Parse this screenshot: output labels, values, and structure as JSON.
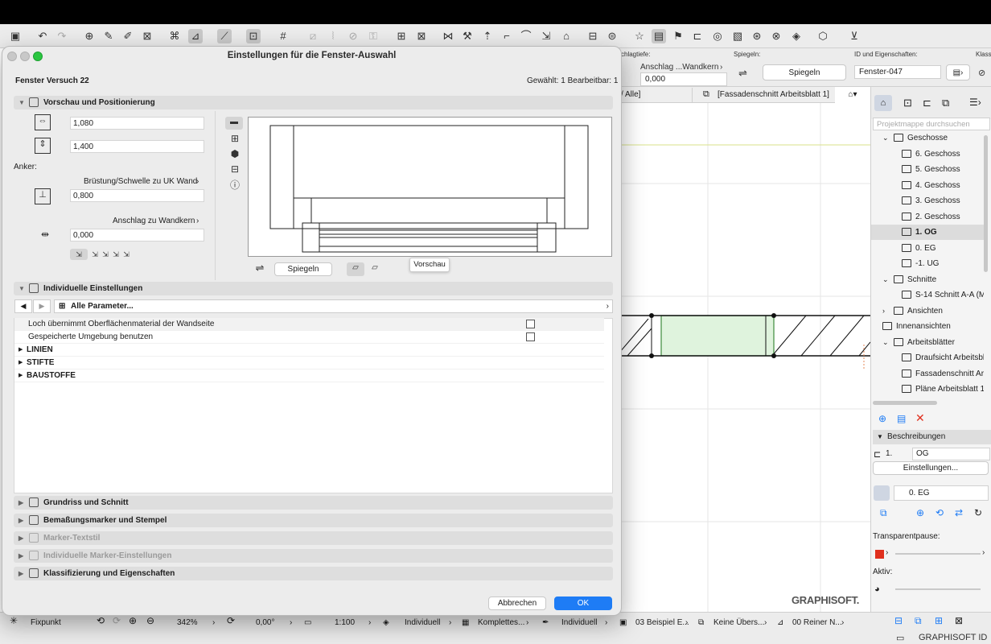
{
  "dialog": {
    "title": "Einstellungen für die Fenster-Auswahl",
    "element_name": "Fenster Versuch 22",
    "selection_info": "Gewählt: 1 Bearbeitbar: 1",
    "preview_section": {
      "title": "Vorschau und Positionierung",
      "width_value": "1,080",
      "height_value": "1,400",
      "anchor_label": "Anker:",
      "sill_label": "Brüstung/Schwelle zu UK Wand",
      "sill_value": "0,800",
      "reveal_label": "Anschlag zu Wandkern",
      "reveal_value": "0,000",
      "mirror_button": "Spiegeln",
      "tooltip": "Vorschau"
    },
    "custom_section": {
      "title": "Individuelle Einstellungen",
      "param_selector": "Alle Parameter...",
      "rows": [
        {
          "label": "Loch übernimmt Oberflächenmaterial der Wandseite",
          "checked": false
        },
        {
          "label": "Gespeicherte Umgebung benutzen",
          "checked": false
        }
      ],
      "groups": [
        "LINIEN",
        "STIFTE",
        "BAUSTOFFE"
      ]
    },
    "collapsed_sections": [
      {
        "title": "Grundriss und Schnitt",
        "enabled": true
      },
      {
        "title": "Bemaßungsmarker und Stempel",
        "enabled": true
      },
      {
        "title": "Marker-Textstil",
        "enabled": false
      },
      {
        "title": "Individuelle Marker-Einstellungen",
        "enabled": false
      },
      {
        "title": "Klassifizierung und Eigenschaften",
        "enabled": true
      }
    ],
    "cancel_label": "Abbrechen",
    "ok_label": "OK"
  },
  "infobox": {
    "depth_label": "chlagtiefe:",
    "reveal_label": "Anschlag ...Wandkern",
    "reveal_value": "0,000",
    "mirror_label": "Spiegeln:",
    "mirror_button": "Spiegeln",
    "id_label": "ID und Eigenschaften:",
    "id_value": "Fenster-047",
    "klass_label": "Klass"
  },
  "view_tabs": {
    "tab1": "/ Alle]",
    "tab2": "[Fassadenschnitt  Arbeitsblatt 1]"
  },
  "navigator": {
    "search_placeholder": "Projektmappe durchsuchen",
    "items": [
      {
        "label": "Geschosse",
        "indent": 0,
        "expanded": true
      },
      {
        "label": "6. Geschoss",
        "indent": 1
      },
      {
        "label": "5. Geschoss",
        "indent": 1
      },
      {
        "label": "4. Geschoss",
        "indent": 1
      },
      {
        "label": "3. Geschoss",
        "indent": 1
      },
      {
        "label": "2. Geschoss",
        "indent": 1
      },
      {
        "label": "1. OG",
        "indent": 1,
        "selected": true
      },
      {
        "label": "0. EG",
        "indent": 1
      },
      {
        "label": "-1. UG",
        "indent": 1
      },
      {
        "label": "Schnitte",
        "indent": 0,
        "expanded": true
      },
      {
        "label": "S-14 Schnitt A-A (M",
        "indent": 1
      },
      {
        "label": "Ansichten",
        "indent": 0,
        "expanded": false
      },
      {
        "label": "Innenansichten",
        "indent": 0
      },
      {
        "label": "Arbeitsblätter",
        "indent": 0,
        "expanded": true
      },
      {
        "label": "Draufsicht  Arbeitsbl",
        "indent": 1
      },
      {
        "label": "Fassadenschnitt  Ar",
        "indent": 1
      },
      {
        "label": "Pläne Arbeitsblatt 1",
        "indent": 1
      }
    ],
    "descriptions_title": "Beschreibungen",
    "desc_number": "1.",
    "desc_value": "OG",
    "settings_button": "Einstellungen...",
    "layer_value": "0. EG",
    "transparent_label": "Transparentpause:",
    "active_label": "Aktiv:",
    "accent_red": "#e0301e"
  },
  "statusbar": {
    "fixpoint": "Fixpunkt",
    "zoom": "342%",
    "angle": "0,00°",
    "scale": "1:100",
    "layer_combo": "Individuell",
    "model_view": "Komplettes...",
    "pen_set": "Individuell",
    "graphic_override": "03 Beispiel E...",
    "renovation": "Keine Übers...",
    "structure": "00 Reiner N..."
  },
  "brand": {
    "canvas_logo": "GRAPHISOFT.",
    "footer_logo": "GRAPHISOFT ID"
  }
}
